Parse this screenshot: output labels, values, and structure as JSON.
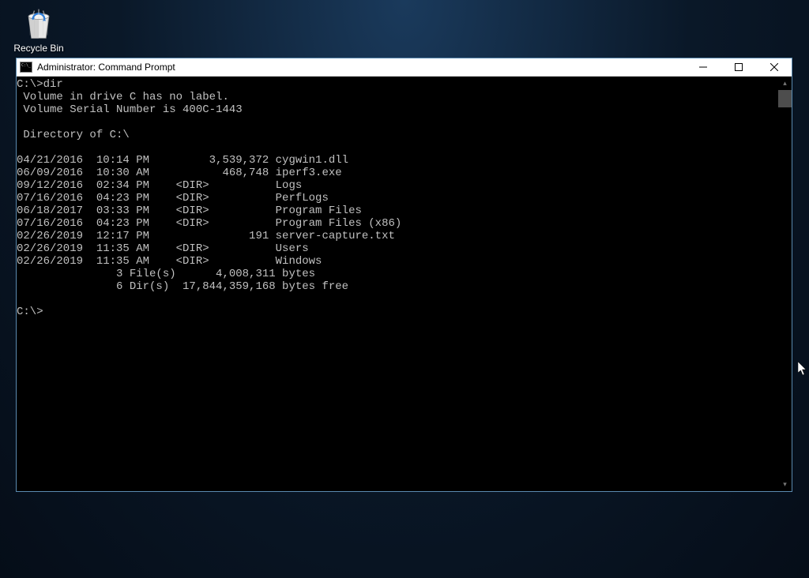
{
  "desktop": {
    "recycleBin": {
      "label": "Recycle Bin"
    }
  },
  "window": {
    "title": "Administrator: Command Prompt"
  },
  "terminal": {
    "prompt1": "C:\\>dir",
    "line_vol": " Volume in drive C has no label.",
    "line_serial": " Volume Serial Number is 400C-1443",
    "blank": "",
    "line_dirof": " Directory of C:\\",
    "entries": [
      "04/21/2016  10:14 PM         3,539,372 cygwin1.dll",
      "06/09/2016  10:30 AM           468,748 iperf3.exe",
      "09/12/2016  02:34 PM    <DIR>          Logs",
      "07/16/2016  04:23 PM    <DIR>          PerfLogs",
      "06/18/2017  03:33 PM    <DIR>          Program Files",
      "07/16/2016  04:23 PM    <DIR>          Program Files (x86)",
      "02/26/2019  12:17 PM               191 server-capture.txt",
      "02/26/2019  11:35 AM    <DIR>          Users",
      "02/26/2019  11:35 AM    <DIR>          Windows"
    ],
    "summary_files": "               3 File(s)      4,008,311 bytes",
    "summary_dirs": "               6 Dir(s)  17,844,359,168 bytes free",
    "prompt2": "C:\\>"
  }
}
